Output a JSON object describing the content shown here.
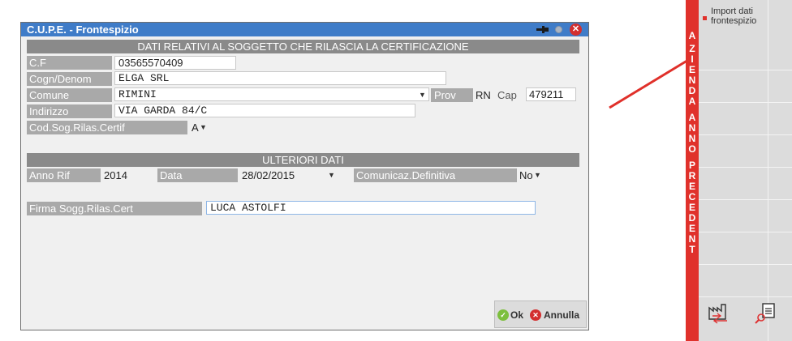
{
  "dialog": {
    "title": "C.U.P.E. - Frontespizio",
    "section1_header": "DATI RELATIVI AL SOGGETTO CHE RILASCIA LA CERTIFICAZIONE",
    "cf_label": "C.F",
    "cf_value": "03565570409",
    "cognome_label": "Cogn/Denom",
    "cognome_value": "ELGA  SRL",
    "comune_label": "Comune",
    "comune_value": "RIMINI",
    "prov_label": "Prov",
    "prov_value": "RN",
    "cap_label": "Cap",
    "cap_value": "479211",
    "indirizzo_label": "Indirizzo",
    "indirizzo_value": "VIA GARDA 84/C",
    "codsog_label": "Cod.Sog.Rilas.Certif",
    "codsog_value": "A",
    "section2_header": "ULTERIORI DATI",
    "anno_label": "Anno Rif",
    "anno_value": "2014",
    "data_label": "Data",
    "data_value": "28/02/2015",
    "comunicaz_label": "Comunicaz.Definitiva",
    "comunicaz_value": "No",
    "firma_label": "Firma Sogg.Rilas.Cert",
    "firma_value": "LUCA ASTOLFI",
    "ok_label": "Ok",
    "annulla_label": "Annulla"
  },
  "side": {
    "vertical_text": "AZIENDA ANNO PRECEDENT",
    "import_label_line1": "Import dati",
    "import_label_line2": "frontespizio"
  },
  "colors": {
    "titlebar": "#3f7cc8",
    "section_header": "#8a8a8a",
    "label_bg": "#a9a9a9",
    "side_red": "#e0312b",
    "arrow_red": "#e0302a"
  }
}
